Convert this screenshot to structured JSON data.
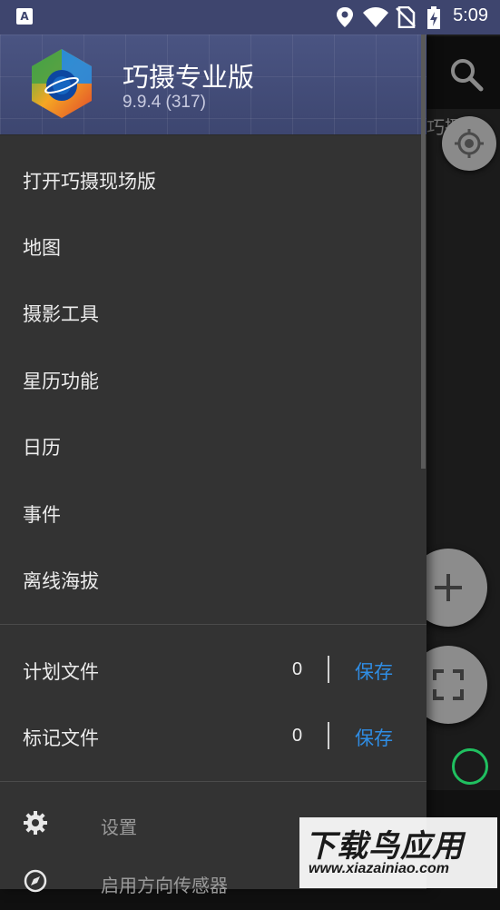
{
  "status_bar": {
    "time": "5:09",
    "app_icon_letter": "A"
  },
  "header": {
    "app_name": "巧摄专业版",
    "version": "9.9.4 (317)"
  },
  "menu": {
    "items": [
      {
        "label": "打开巧摄现场版"
      },
      {
        "label": "地图"
      },
      {
        "label": "摄影工具"
      },
      {
        "label": "星历功能"
      },
      {
        "label": "日历"
      },
      {
        "label": "事件"
      },
      {
        "label": "离线海拔"
      }
    ]
  },
  "files": [
    {
      "label": "计划文件",
      "count": "0",
      "action": "保存"
    },
    {
      "label": "标记文件",
      "count": "0",
      "action": "保存"
    }
  ],
  "bottom_items": [
    {
      "label": "设置",
      "icon": "gear-icon"
    },
    {
      "label": "启用方向传感器",
      "icon": "compass-icon"
    }
  ],
  "background": {
    "title_fragment": "巧摄"
  },
  "watermark": {
    "main": "下载鸟应用",
    "sub": "www.xiazainiao.com"
  },
  "colors": {
    "header_bg": "#3d4670",
    "drawer_bg": "#333333",
    "accent_blue": "#2f8de4",
    "calendar_green": "#20c060"
  }
}
